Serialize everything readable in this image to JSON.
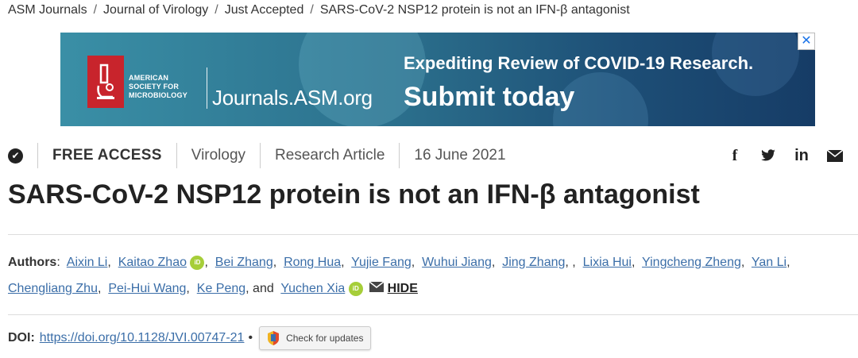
{
  "breadcrumb": {
    "items": [
      "ASM Journals",
      "Journal of Virology",
      "Just Accepted",
      "SARS-CoV-2 NSP12 protein is not an IFN-β antagonist"
    ],
    "separator": "/"
  },
  "banner": {
    "org_line1": "AMERICAN",
    "org_line2": "SOCIETY FOR",
    "org_line3": "MICROBIOLOGY",
    "journals": "Journals.ASM.org",
    "headline": "Expediting Review of COVID-19 Research.",
    "cta": "Submit today",
    "close": "✕"
  },
  "meta": {
    "access": "FREE ACCESS",
    "subject": "Virology",
    "type": "Research Article",
    "date": "16 June 2021"
  },
  "share": {
    "facebook": "f",
    "twitter": "🐦",
    "linkedin": "in"
  },
  "article": {
    "title": "SARS-CoV-2 NSP12 protein is not an IFN-β antagonist"
  },
  "authors": {
    "label": "Authors",
    "names": [
      "Aixin Li",
      "Kaitao Zhao",
      "Bei Zhang",
      "Rong Hua",
      "Yujie Fang",
      "Wuhui Jiang",
      "Jing Zhang",
      "Lixia Hui",
      "Yingcheng Zheng",
      "Yan Li",
      "Chengliang Zhu",
      "Pei-Hui Wang",
      "Ke Peng",
      "Yuchen Xia"
    ],
    "and": "and",
    "orcid": "iD",
    "hide": "HIDE"
  },
  "doi": {
    "label": "DOI:",
    "url": "https://doi.org/10.1128/JVI.00747-21",
    "bullet": "•",
    "check_updates": "Check for updates"
  },
  "colors": {
    "link": "#3b6ea8",
    "asm_red": "#c8242c",
    "orcid_green": "#a6ce39"
  }
}
